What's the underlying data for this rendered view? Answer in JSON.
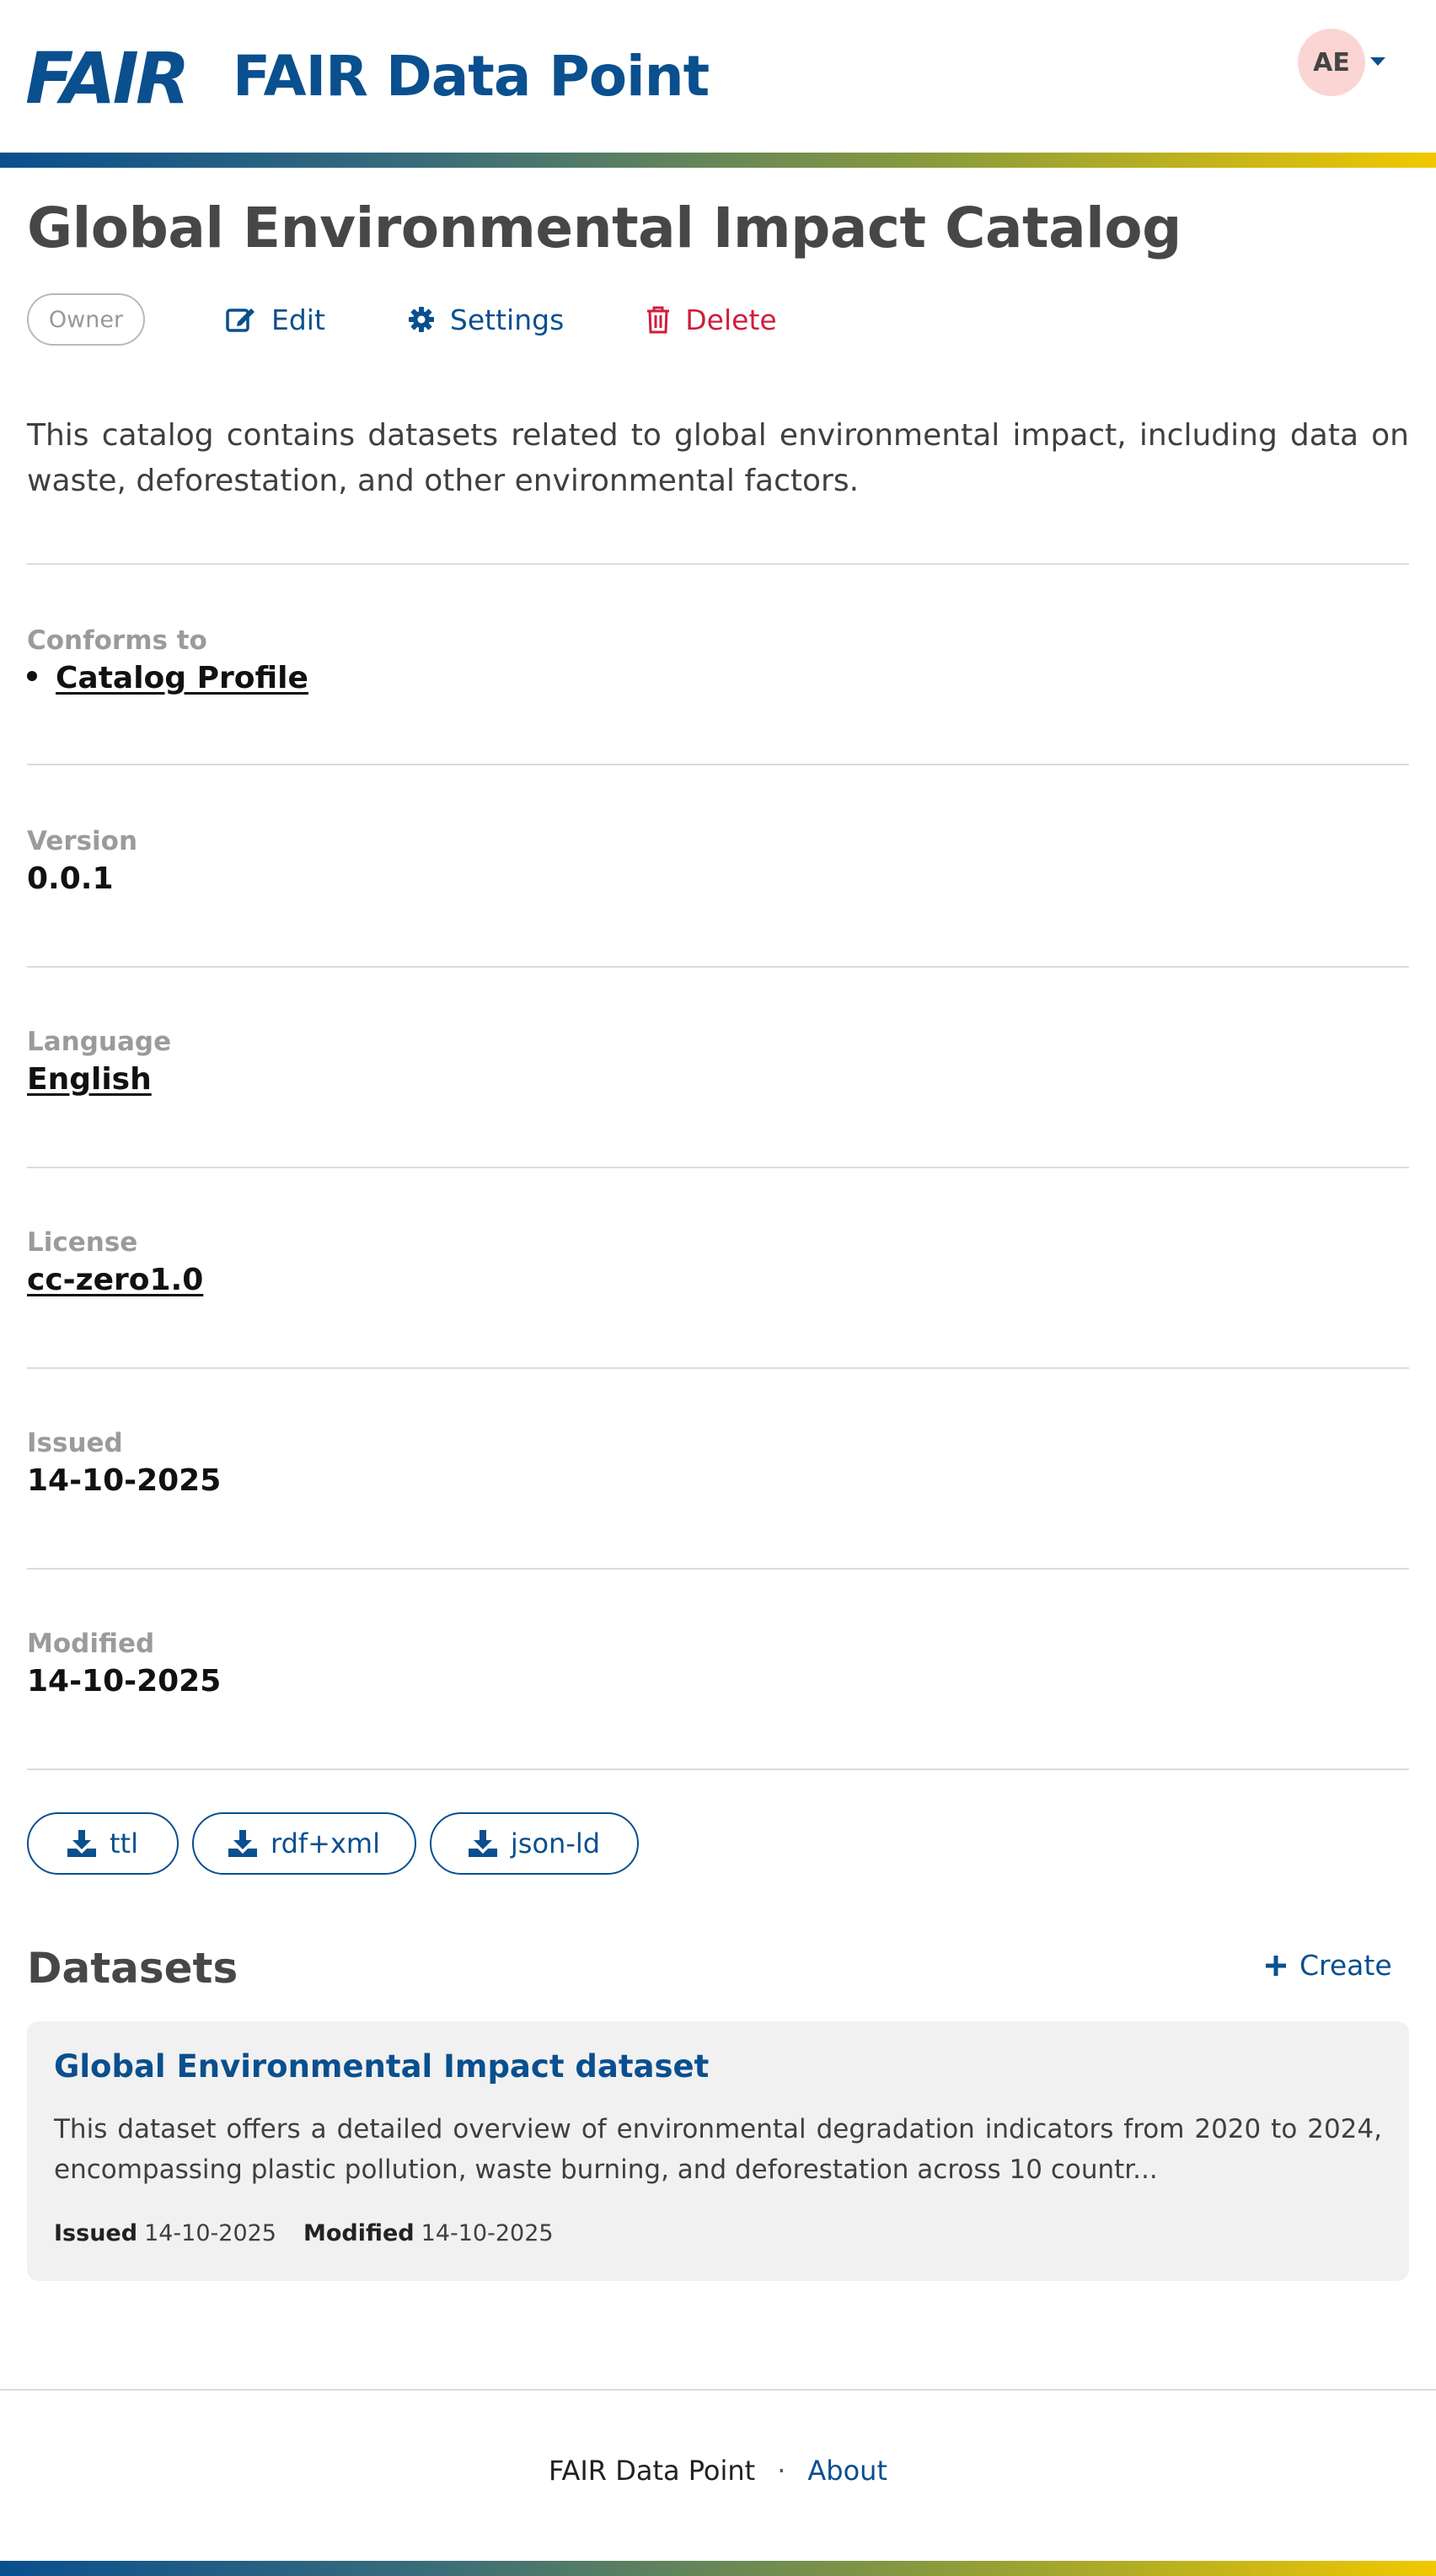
{
  "header": {
    "logo_text": "FAIR",
    "app_title": "FAIR Data Point",
    "avatar_initials": "AE"
  },
  "catalog": {
    "title": "Global Environmental Impact Catalog",
    "owner_badge": "Owner",
    "actions": {
      "edit": "Edit",
      "settings": "Settings",
      "delete": "Delete"
    },
    "description": "This catalog contains datasets related to global environmental impact, including data on waste, deforestation, and other environmental factors."
  },
  "metadata": {
    "conforms_to": {
      "label": "Conforms to",
      "items": [
        "Catalog Profile"
      ]
    },
    "version": {
      "label": "Version",
      "value": "0.0.1"
    },
    "language": {
      "label": "Language",
      "value": "English"
    },
    "license": {
      "label": "License",
      "value": "cc-zero1.0"
    },
    "issued": {
      "label": "Issued",
      "value": "14-10-2025"
    },
    "modified": {
      "label": "Modified",
      "value": "14-10-2025"
    }
  },
  "downloads": [
    "ttl",
    "rdf+xml",
    "json-ld"
  ],
  "datasets": {
    "heading": "Datasets",
    "create_label": "Create",
    "items": [
      {
        "title": "Global Environmental Impact dataset",
        "description": "This dataset offers a detailed overview of environmental degradation indicators from 2020 to 2024, encompassing plastic pollution, waste burning, and deforestation across 10 countr...",
        "issued_label": "Issued",
        "issued": "14-10-2025",
        "modified_label": "Modified",
        "modified": "14-10-2025"
      }
    ]
  },
  "footer": {
    "brand": "FAIR Data Point",
    "separator": "·",
    "about": "About"
  },
  "colors": {
    "brand_blue": "#0a4f8e",
    "danger_red": "#d11d3a",
    "accent_yellow": "#f1c800",
    "avatar_bg": "#fbd5d3"
  }
}
